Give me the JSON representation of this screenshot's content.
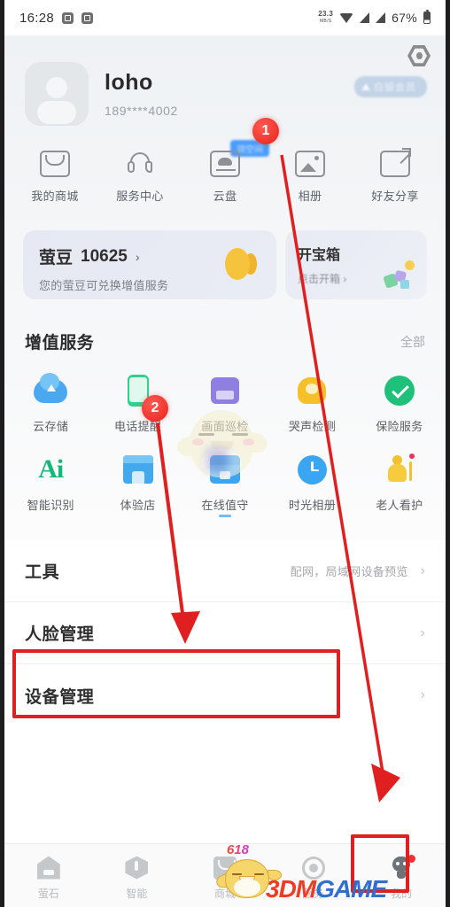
{
  "status_bar": {
    "time": "16:28",
    "temperature": "23.3",
    "temperature_unit": "MB/S",
    "battery_percent": "67%",
    "icons": [
      "screenshot-icon",
      "screenshot-icon",
      "temperature-indicator",
      "wifi-icon",
      "signal-icon",
      "signal-icon",
      "battery-icon"
    ]
  },
  "header": {
    "settings_icon": "gear-icon"
  },
  "profile": {
    "name": "loho",
    "phone": "189****4002",
    "vip_badge": "白银会员",
    "avatar_icon": "user-avatar-placeholder"
  },
  "quick_actions": [
    {
      "label": "我的商城",
      "icon": "mail-icon",
      "badge": ""
    },
    {
      "label": "服务中心",
      "icon": "headset-icon",
      "badge": ""
    },
    {
      "label": "云盘",
      "icon": "cloud-disk-icon",
      "badge": "领空间"
    },
    {
      "label": "相册",
      "icon": "photo-icon",
      "badge": ""
    },
    {
      "label": "好友分享",
      "icon": "share-icon",
      "badge": ""
    }
  ],
  "promos": {
    "main": {
      "title_text": "萤豆",
      "amount": "10625",
      "chevron": "›",
      "subtitle": "您的萤豆可兑换增值服务",
      "icon": "coin-icon"
    },
    "side": {
      "title": "开宝箱",
      "subtitle": "点击开箱 ›",
      "icon": "gift-box-icon"
    }
  },
  "value_added": {
    "title": "增值服务",
    "all_label": "全部",
    "items": [
      {
        "label": "云存储",
        "icon": "cloud-storage-icon"
      },
      {
        "label": "电话提醒",
        "icon": "phone-alert-icon"
      },
      {
        "label": "画面巡检",
        "icon": "screen-inspection-icon"
      },
      {
        "label": "哭声检测",
        "icon": "cry-detection-icon"
      },
      {
        "label": "保险服务",
        "icon": "insurance-shield-icon"
      },
      {
        "label": "智能识别",
        "icon": "ai-icon"
      },
      {
        "label": "体验店",
        "icon": "store-icon"
      },
      {
        "label": "在线值守",
        "icon": "online-duty-icon"
      },
      {
        "label": "时光相册",
        "icon": "clock-album-icon"
      },
      {
        "label": "老人看护",
        "icon": "elder-care-icon"
      }
    ]
  },
  "list_rows": [
    {
      "title": "工具",
      "desc": "配网，局域网设备预览",
      "chevron": "›"
    },
    {
      "title": "人脸管理",
      "desc": "",
      "chevron": "›"
    },
    {
      "title": "设备管理",
      "desc": "",
      "chevron": "›"
    }
  ],
  "bottom_nav": [
    {
      "label": "萤石",
      "icon": "home-icon",
      "badge": "",
      "active": false
    },
    {
      "label": "智能",
      "icon": "smart-icon",
      "badge": "",
      "active": false
    },
    {
      "label": "商城",
      "icon": "mall-icon",
      "badge": "618",
      "active": false
    },
    {
      "label": "服务",
      "icon": "service-icon",
      "badge": "",
      "active": false
    },
    {
      "label": "我的",
      "icon": "profile-icon",
      "badge": "dot",
      "active": true
    }
  ],
  "annotations": {
    "marker_1": "1",
    "marker_2": "2",
    "highlight_tools": "red-box-around-tools-row",
    "highlight_me": "red-box-around-profile-tab",
    "arrow_color": "#e02020"
  },
  "watermark": {
    "text_red": "3DM",
    "text_blue": "GAME",
    "mascot": "chick-mascot-icon"
  }
}
